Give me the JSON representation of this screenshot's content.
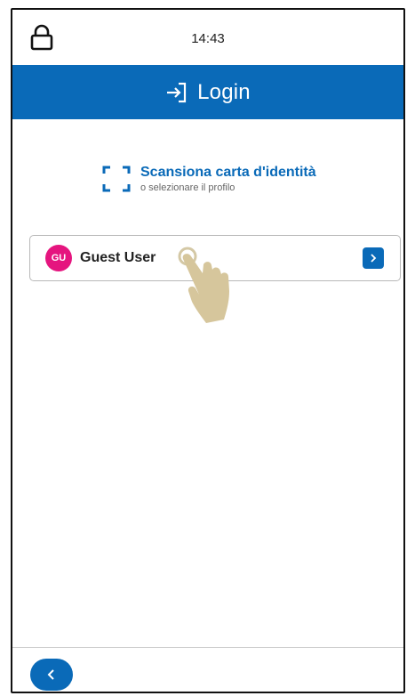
{
  "status_bar": {
    "time": "14:43",
    "lock_icon": "lock-icon"
  },
  "header": {
    "icon": "login-arrow-icon",
    "title": "Login",
    "color": "#0a6ab8"
  },
  "scan": {
    "icon": "scan-frame-icon",
    "title": "Scansiona carta d'identità",
    "subtitle": "o selezionare il profilo"
  },
  "profiles": [
    {
      "initials": "GU",
      "name": "Guest User",
      "avatar_color": "#e5157f",
      "action_icon": "chevron-right-icon"
    }
  ],
  "overlay": {
    "icon": "tap-hand-icon"
  },
  "footer": {
    "back_icon": "chevron-left-icon"
  }
}
